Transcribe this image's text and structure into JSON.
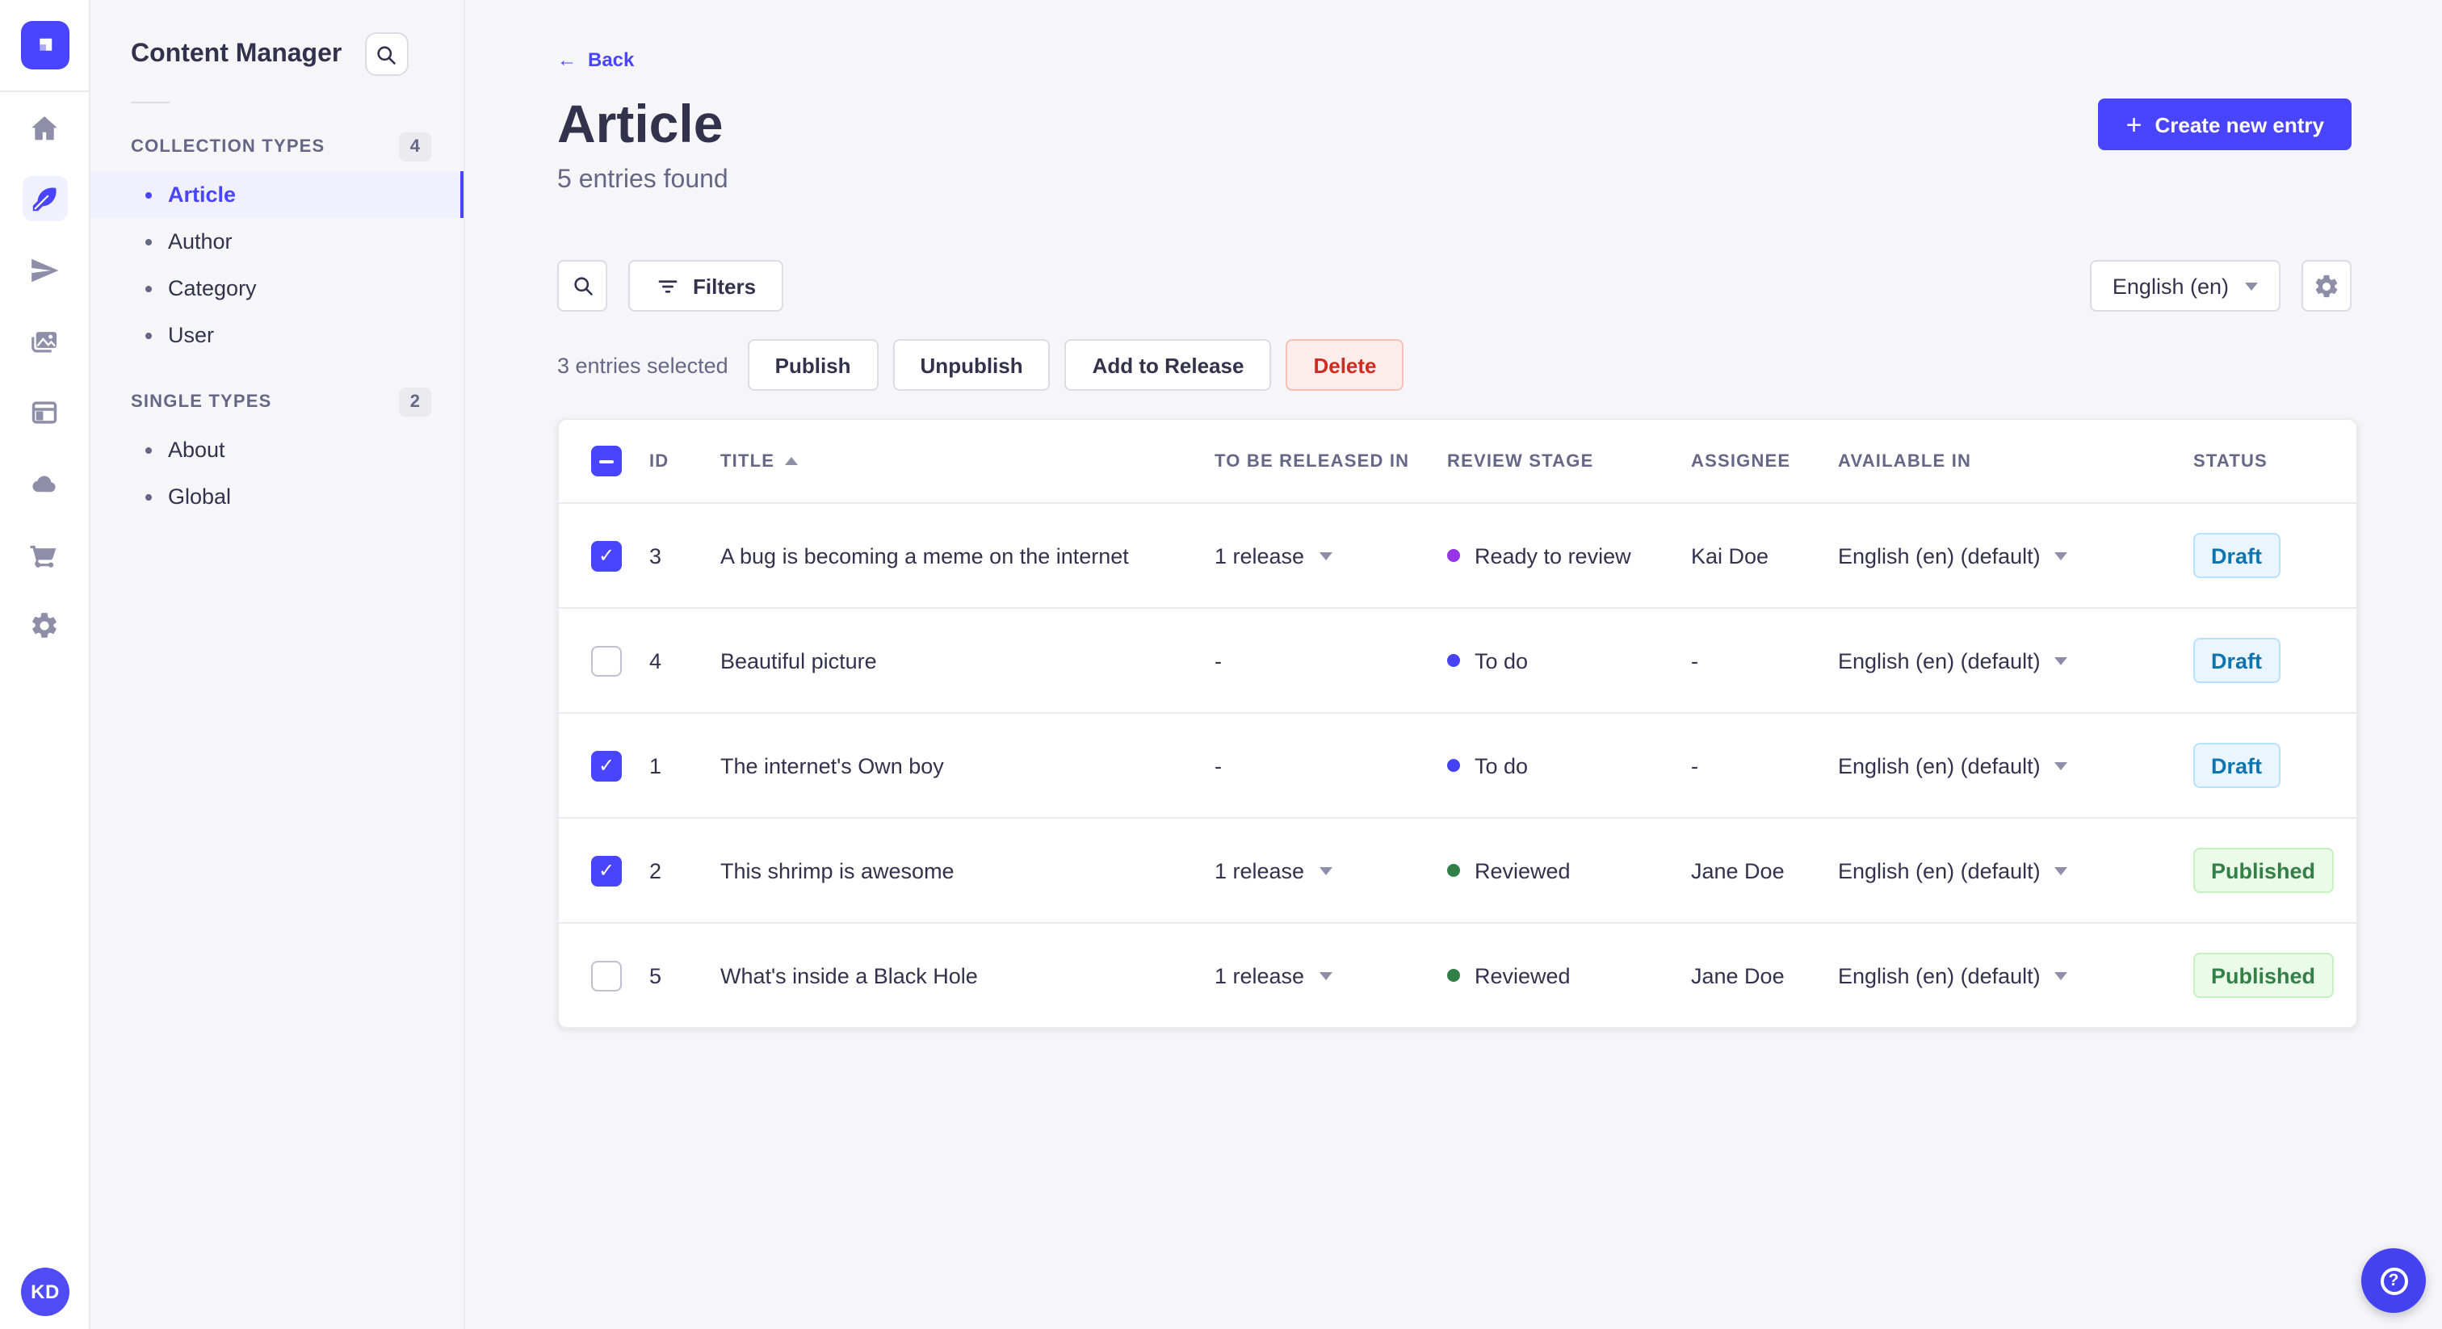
{
  "colors": {
    "primary": "#4945ff",
    "primary_light": "#f0f0ff",
    "page_bg": "#f6f6f9",
    "draft_text": "#0c75af",
    "draft_bg": "#eaf5ff",
    "draft_border": "#b8e1ff",
    "published_text": "#328048",
    "published_bg": "#eafbe7",
    "published_border": "#c6f0c2",
    "delete_text": "#d02b20",
    "delete_bg": "#fcecea",
    "delete_border": "#f5c0b8",
    "stage_purple": "#9736e8",
    "stage_blue": "#4543f5",
    "stage_green": "#328048"
  },
  "icons": {
    "back_arrow": "←",
    "plus": "+",
    "help": "?"
  },
  "rail": {
    "avatar": "KD",
    "items": [
      {
        "name": "home",
        "active": false
      },
      {
        "name": "content-manager",
        "active": true
      },
      {
        "name": "releases",
        "active": false
      },
      {
        "name": "media-library",
        "active": false
      },
      {
        "name": "content-type-builder",
        "active": false
      },
      {
        "name": "cloud",
        "active": false
      },
      {
        "name": "marketplace",
        "active": false
      },
      {
        "name": "settings",
        "active": false
      }
    ]
  },
  "panel": {
    "title": "Content Manager",
    "sections": [
      {
        "label": "COLLECTION TYPES",
        "count": "4",
        "items": [
          {
            "label": "Article",
            "active": true
          },
          {
            "label": "Author",
            "active": false
          },
          {
            "label": "Category",
            "active": false
          },
          {
            "label": "User",
            "active": false
          }
        ]
      },
      {
        "label": "SINGLE TYPES",
        "count": "2",
        "items": [
          {
            "label": "About",
            "active": false
          },
          {
            "label": "Global",
            "active": false
          }
        ]
      }
    ]
  },
  "header": {
    "back": "Back",
    "title": "Article",
    "subtitle": "5 entries found",
    "create_label": "Create new entry"
  },
  "controls": {
    "filters_label": "Filters",
    "locale_value": "English (en)"
  },
  "selection": {
    "text": "3 entries selected",
    "publish": "Publish",
    "unpublish": "Unpublish",
    "add_to_release": "Add to Release",
    "delete": "Delete"
  },
  "table": {
    "select_all_state": "indeterminate",
    "headers": {
      "id": "ID",
      "title": "TITLE",
      "released": "TO BE RELEASED IN",
      "review": "REVIEW STAGE",
      "assignee": "ASSIGNEE",
      "available": "AVAILABLE IN",
      "status": "STATUS"
    },
    "rows": [
      {
        "checked": "checked",
        "id": "3",
        "title": "A bug is becoming a meme on the internet",
        "released": "1 release",
        "released_caret": true,
        "stage": "Ready to review",
        "stage_color": "purple",
        "assignee": "Kai Doe",
        "available": "English (en) (default)",
        "status": "Draft",
        "status_variant": "draft"
      },
      {
        "checked": "unchecked",
        "id": "4",
        "title": "Beautiful picture",
        "released": "-",
        "released_caret": false,
        "stage": "To do",
        "stage_color": "blue",
        "assignee": "-",
        "available": "English (en) (default)",
        "status": "Draft",
        "status_variant": "draft"
      },
      {
        "checked": "checked",
        "id": "1",
        "title": "The internet's Own boy",
        "released": "-",
        "released_caret": false,
        "stage": "To do",
        "stage_color": "blue",
        "assignee": "-",
        "available": "English (en) (default)",
        "status": "Draft",
        "status_variant": "draft"
      },
      {
        "checked": "checked",
        "id": "2",
        "title": "This shrimp is awesome",
        "released": "1 release",
        "released_caret": true,
        "stage": "Reviewed",
        "stage_color": "green",
        "assignee": "Jane Doe",
        "available": "English (en) (default)",
        "status": "Published",
        "status_variant": "published"
      },
      {
        "checked": "unchecked",
        "id": "5",
        "title": "What's inside a Black Hole",
        "released": "1 release",
        "released_caret": true,
        "stage": "Reviewed",
        "stage_color": "green",
        "assignee": "Jane Doe",
        "available": "English (en) (default)",
        "status": "Published",
        "status_variant": "published"
      }
    ]
  }
}
